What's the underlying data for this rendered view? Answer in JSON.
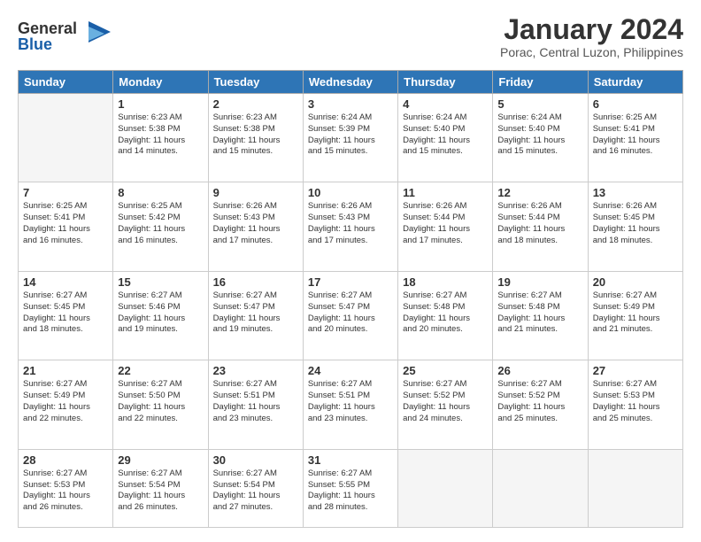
{
  "header": {
    "logo_line1": "General",
    "logo_line2": "Blue",
    "month": "January 2024",
    "location": "Porac, Central Luzon, Philippines"
  },
  "weekdays": [
    "Sunday",
    "Monday",
    "Tuesday",
    "Wednesday",
    "Thursday",
    "Friday",
    "Saturday"
  ],
  "weeks": [
    [
      {
        "day": "",
        "info": ""
      },
      {
        "day": "1",
        "info": "Sunrise: 6:23 AM\nSunset: 5:38 PM\nDaylight: 11 hours\nand 14 minutes."
      },
      {
        "day": "2",
        "info": "Sunrise: 6:23 AM\nSunset: 5:38 PM\nDaylight: 11 hours\nand 15 minutes."
      },
      {
        "day": "3",
        "info": "Sunrise: 6:24 AM\nSunset: 5:39 PM\nDaylight: 11 hours\nand 15 minutes."
      },
      {
        "day": "4",
        "info": "Sunrise: 6:24 AM\nSunset: 5:40 PM\nDaylight: 11 hours\nand 15 minutes."
      },
      {
        "day": "5",
        "info": "Sunrise: 6:24 AM\nSunset: 5:40 PM\nDaylight: 11 hours\nand 15 minutes."
      },
      {
        "day": "6",
        "info": "Sunrise: 6:25 AM\nSunset: 5:41 PM\nDaylight: 11 hours\nand 16 minutes."
      }
    ],
    [
      {
        "day": "7",
        "info": "Sunrise: 6:25 AM\nSunset: 5:41 PM\nDaylight: 11 hours\nand 16 minutes."
      },
      {
        "day": "8",
        "info": "Sunrise: 6:25 AM\nSunset: 5:42 PM\nDaylight: 11 hours\nand 16 minutes."
      },
      {
        "day": "9",
        "info": "Sunrise: 6:26 AM\nSunset: 5:43 PM\nDaylight: 11 hours\nand 17 minutes."
      },
      {
        "day": "10",
        "info": "Sunrise: 6:26 AM\nSunset: 5:43 PM\nDaylight: 11 hours\nand 17 minutes."
      },
      {
        "day": "11",
        "info": "Sunrise: 6:26 AM\nSunset: 5:44 PM\nDaylight: 11 hours\nand 17 minutes."
      },
      {
        "day": "12",
        "info": "Sunrise: 6:26 AM\nSunset: 5:44 PM\nDaylight: 11 hours\nand 18 minutes."
      },
      {
        "day": "13",
        "info": "Sunrise: 6:26 AM\nSunset: 5:45 PM\nDaylight: 11 hours\nand 18 minutes."
      }
    ],
    [
      {
        "day": "14",
        "info": "Sunrise: 6:27 AM\nSunset: 5:45 PM\nDaylight: 11 hours\nand 18 minutes."
      },
      {
        "day": "15",
        "info": "Sunrise: 6:27 AM\nSunset: 5:46 PM\nDaylight: 11 hours\nand 19 minutes."
      },
      {
        "day": "16",
        "info": "Sunrise: 6:27 AM\nSunset: 5:47 PM\nDaylight: 11 hours\nand 19 minutes."
      },
      {
        "day": "17",
        "info": "Sunrise: 6:27 AM\nSunset: 5:47 PM\nDaylight: 11 hours\nand 20 minutes."
      },
      {
        "day": "18",
        "info": "Sunrise: 6:27 AM\nSunset: 5:48 PM\nDaylight: 11 hours\nand 20 minutes."
      },
      {
        "day": "19",
        "info": "Sunrise: 6:27 AM\nSunset: 5:48 PM\nDaylight: 11 hours\nand 21 minutes."
      },
      {
        "day": "20",
        "info": "Sunrise: 6:27 AM\nSunset: 5:49 PM\nDaylight: 11 hours\nand 21 minutes."
      }
    ],
    [
      {
        "day": "21",
        "info": "Sunrise: 6:27 AM\nSunset: 5:49 PM\nDaylight: 11 hours\nand 22 minutes."
      },
      {
        "day": "22",
        "info": "Sunrise: 6:27 AM\nSunset: 5:50 PM\nDaylight: 11 hours\nand 22 minutes."
      },
      {
        "day": "23",
        "info": "Sunrise: 6:27 AM\nSunset: 5:51 PM\nDaylight: 11 hours\nand 23 minutes."
      },
      {
        "day": "24",
        "info": "Sunrise: 6:27 AM\nSunset: 5:51 PM\nDaylight: 11 hours\nand 23 minutes."
      },
      {
        "day": "25",
        "info": "Sunrise: 6:27 AM\nSunset: 5:52 PM\nDaylight: 11 hours\nand 24 minutes."
      },
      {
        "day": "26",
        "info": "Sunrise: 6:27 AM\nSunset: 5:52 PM\nDaylight: 11 hours\nand 25 minutes."
      },
      {
        "day": "27",
        "info": "Sunrise: 6:27 AM\nSunset: 5:53 PM\nDaylight: 11 hours\nand 25 minutes."
      }
    ],
    [
      {
        "day": "28",
        "info": "Sunrise: 6:27 AM\nSunset: 5:53 PM\nDaylight: 11 hours\nand 26 minutes."
      },
      {
        "day": "29",
        "info": "Sunrise: 6:27 AM\nSunset: 5:54 PM\nDaylight: 11 hours\nand 26 minutes."
      },
      {
        "day": "30",
        "info": "Sunrise: 6:27 AM\nSunset: 5:54 PM\nDaylight: 11 hours\nand 27 minutes."
      },
      {
        "day": "31",
        "info": "Sunrise: 6:27 AM\nSunset: 5:55 PM\nDaylight: 11 hours\nand 28 minutes."
      },
      {
        "day": "",
        "info": ""
      },
      {
        "day": "",
        "info": ""
      },
      {
        "day": "",
        "info": ""
      }
    ]
  ]
}
